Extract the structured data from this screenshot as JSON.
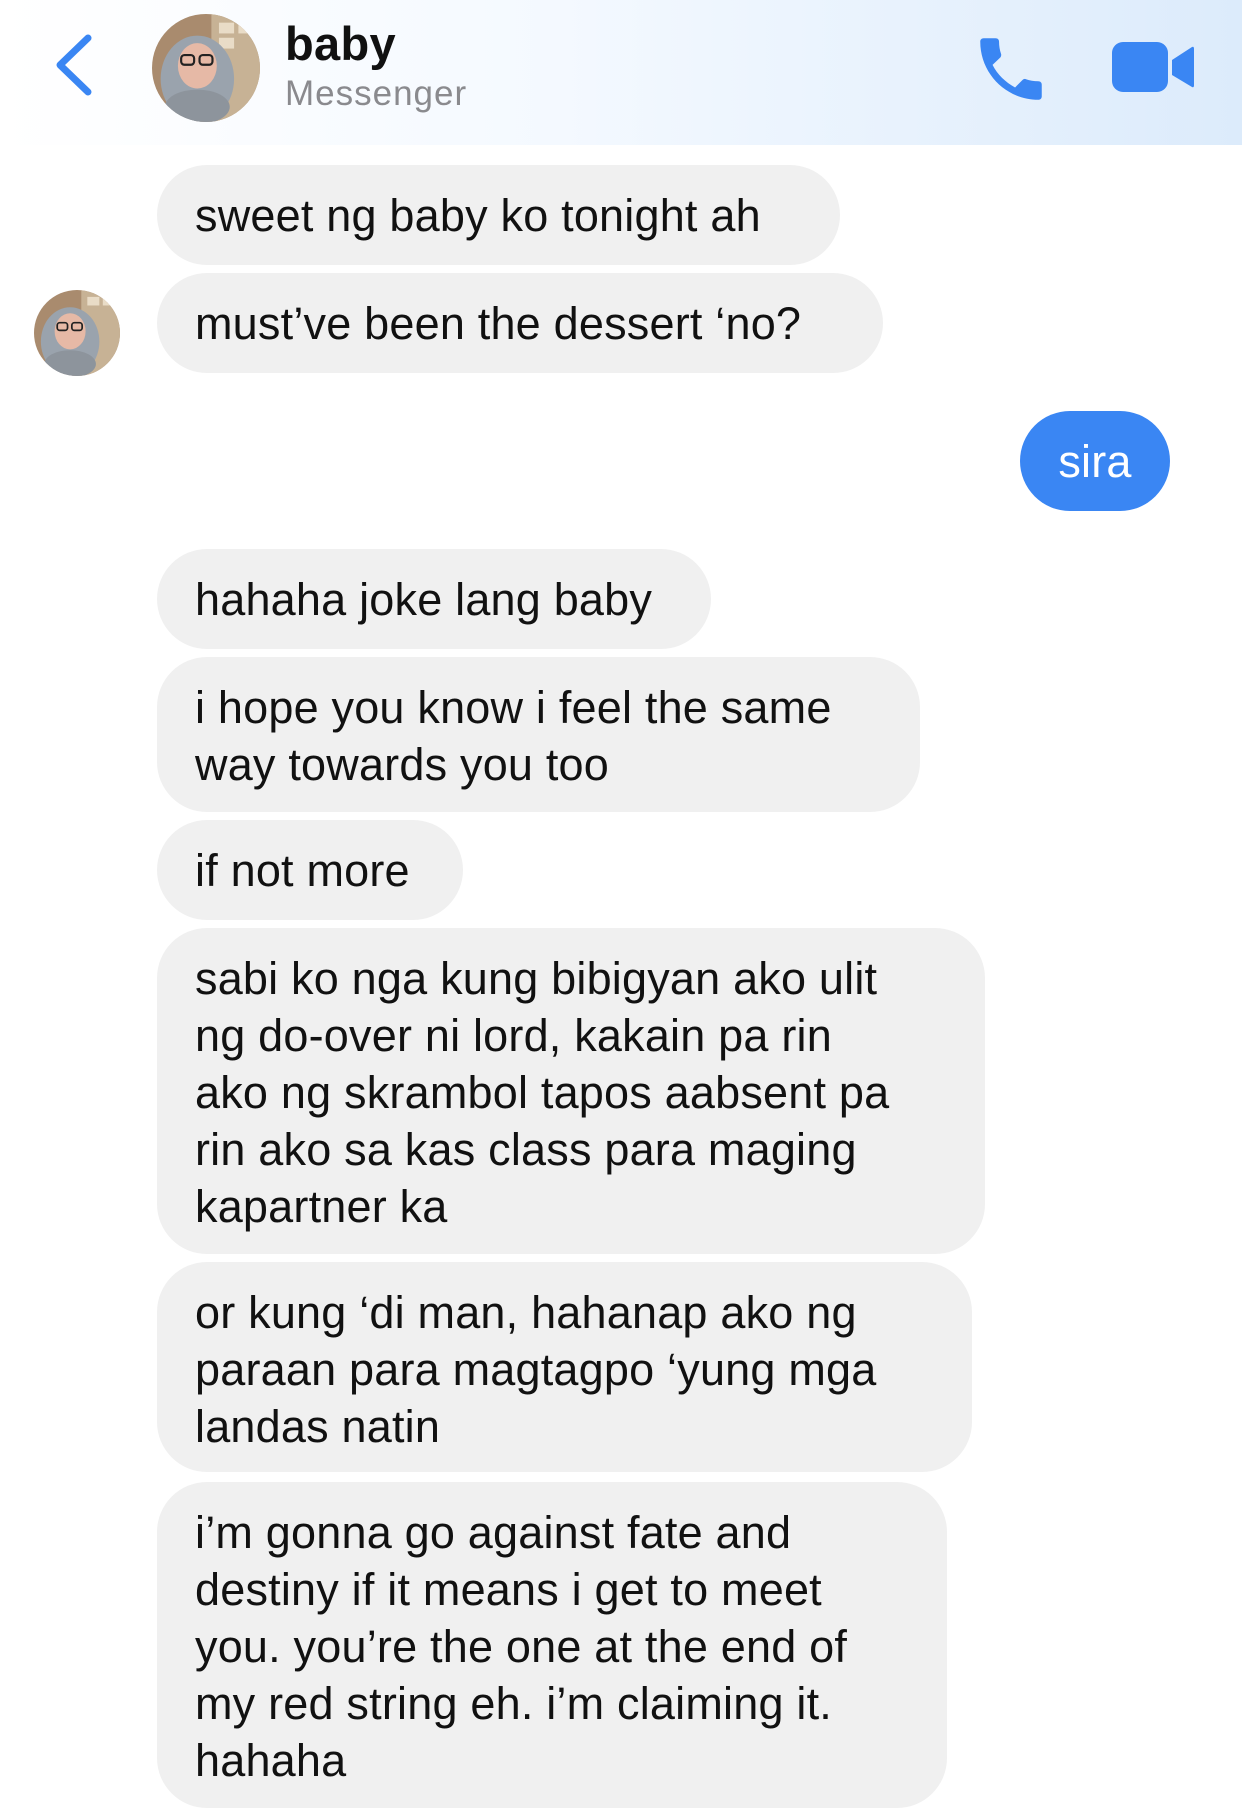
{
  "header": {
    "contact_name": "baby",
    "contact_subtitle": "Messenger",
    "back_icon": "chevron-left-icon",
    "call_icon": "phone-icon",
    "video_icon": "video-camera-icon",
    "accent_color": "#3a86f3"
  },
  "messages": [
    {
      "direction": "received",
      "text": "sweet ng baby ko tonight ah"
    },
    {
      "direction": "received",
      "text": "must’ve been the dessert ‘no?"
    },
    {
      "direction": "sent",
      "text": "sira"
    },
    {
      "direction": "received",
      "text": "hahaha joke lang baby"
    },
    {
      "direction": "received",
      "text": "i hope you know i feel the same\nway towards you too"
    },
    {
      "direction": "received",
      "text": "if not more"
    },
    {
      "direction": "received",
      "text": "sabi ko nga kung bibigyan ako ulit\nng do-over ni lord, kakain pa rin\nako ng skrambol tapos aabsent pa\nrin ako sa kas class para maging\nkapartner ka"
    },
    {
      "direction": "received",
      "text": "or kung ‘di man, hahanap ako ng\nparaan para magtagpo ‘yung mga\nlandas natin"
    },
    {
      "direction": "received",
      "text": "i’m gonna go against fate and\ndestiny if it means i get to meet\nyou. you’re the one at the end of\nmy red string eh. i’m claiming it.\nhahaha"
    }
  ]
}
